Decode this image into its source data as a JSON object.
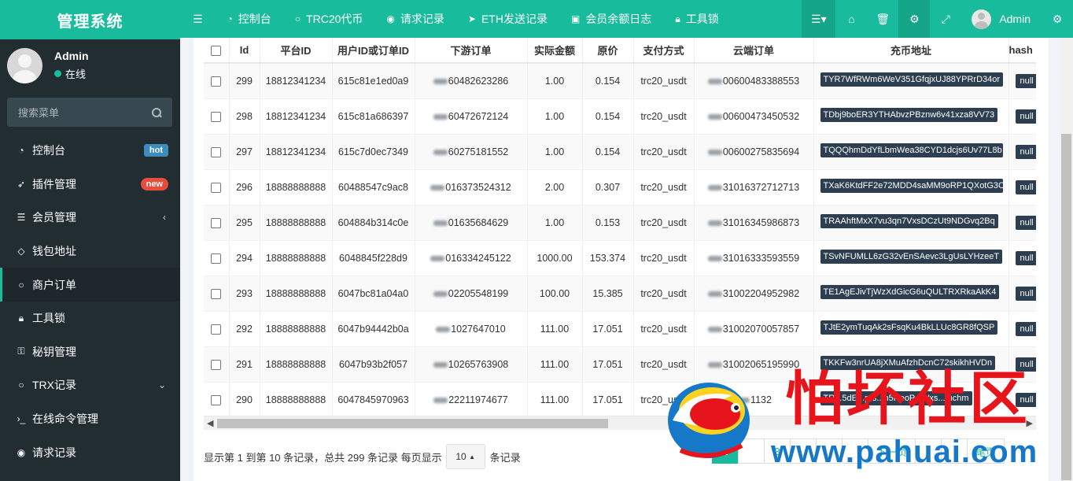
{
  "app": {
    "title": "管理系统"
  },
  "user": {
    "name": "Admin",
    "status": "在线"
  },
  "sidebar": {
    "search_placeholder": "搜索菜单",
    "items": [
      {
        "label": "控制台",
        "icon": "dashboard-icon",
        "badge": "hot"
      },
      {
        "label": "插件管理",
        "icon": "rocket-icon",
        "badge": "new"
      },
      {
        "label": "会员管理",
        "icon": "list-icon",
        "chevron": "‹"
      },
      {
        "label": "钱包地址",
        "icon": "diamond-icon"
      },
      {
        "label": "商户订单",
        "icon": "circle-icon",
        "active": true
      },
      {
        "label": "工具锁",
        "icon": "lock-icon"
      },
      {
        "label": "秘钥管理",
        "icon": "key-icon"
      },
      {
        "label": "TRX记录",
        "icon": "circle-icon",
        "chevron": "⌄"
      },
      {
        "label": "在线命令管理",
        "icon": "terminal-icon"
      },
      {
        "label": "请求记录",
        "icon": "arrow-circle-icon"
      }
    ]
  },
  "topbar": {
    "toggle_icon": "menu-toggle-icon",
    "tabs": [
      {
        "label": "控制台",
        "icon": "dashboard-icon"
      },
      {
        "label": "TRC20代币",
        "icon": "circle-icon"
      },
      {
        "label": "请求记录",
        "icon": "arrow-circle-icon"
      },
      {
        "label": "ETH发送记录",
        "icon": "send-icon"
      },
      {
        "label": "会员余额日志",
        "icon": "money-icon"
      },
      {
        "label": "工具锁",
        "icon": "lock-icon"
      }
    ],
    "user_name": "Admin"
  },
  "table": {
    "columns": [
      "Id",
      "平台ID",
      "用户ID或订单ID",
      "下游订单",
      "实际金额",
      "原价",
      "支付方式",
      "云端订单",
      "充币地址",
      "hash"
    ],
    "rows": [
      [
        "299",
        "18812341234",
        "615c81e1ed0a9",
        "60482623286",
        "1.00",
        "0.154",
        "trc20_usdt",
        "00600483388553",
        "TYR7WfRWm6WeV351GfqjxUJ88YPRrD34or",
        "null"
      ],
      [
        "298",
        "18812341234",
        "615c81a686397",
        "60472672124",
        "1.00",
        "0.154",
        "trc20_usdt",
        "00600473450532",
        "TDbj9boER3YTHAbvzPBznw6v41xza8VV73",
        "null"
      ],
      [
        "297",
        "18812341234",
        "615c7d0ec7349",
        "60275181552",
        "1.00",
        "0.154",
        "trc20_usdt",
        "00600275835694",
        "TQQQhmDdYfLbmWea38CYD1dcjs6Uv77L8b",
        "null"
      ],
      [
        "296",
        "18888888888",
        "60488547c9ac8",
        "016373524312",
        "2.00",
        "0.307",
        "trc20_usdt",
        "31016372712713",
        "TXaK6KtdFF2e72MDD4saMM9oRP1QXotG3C",
        "null"
      ],
      [
        "295",
        "18888888888",
        "604884b314c0e",
        "01635684629",
        "1.00",
        "0.153",
        "trc20_usdt",
        "31016345986873",
        "TRAAhftMxX7vu3qn7VxsDCzUt9NDGvq2Bq",
        "null"
      ],
      [
        "294",
        "18888888888",
        "6048845f228d9",
        "016334245122",
        "1000.00",
        "153.374",
        "trc20_usdt",
        "31016333593559",
        "TSvNFUMLL6zG32vEnSAevc3LgUsLYHzeeT",
        "null"
      ],
      [
        "293",
        "18888888888",
        "6047bc81a04a0",
        "02205548199",
        "100.00",
        "15.385",
        "trc20_usdt",
        "31002204952982",
        "TE1AgEJivTjWzXdGicG6uQULTRXRkaAkK4",
        "null"
      ],
      [
        "292",
        "18888888888",
        "6047b94442b0a",
        "1027647010",
        "111.00",
        "17.051",
        "trc20_usdt",
        "31002070057857",
        "TJtE2ymTuqAk2sFsqKu4BkLLUc8GR8fQSP",
        "null"
      ],
      [
        "291",
        "18888888888",
        "6047b93b2f057",
        "10265763908",
        "111.00",
        "17.051",
        "trc20_usdt",
        "31002065195990",
        "TKKFw3nrUA8jXMuAfzhDcnC72skikhHVDn",
        "null"
      ],
      [
        "290",
        "18888888888",
        "6047845970963",
        "22211974677",
        "111.00",
        "17.051",
        "trc20_usdt",
        "1132",
        "TR...5dE...prs...h5HeoP...Wxs...mchm",
        "null"
      ]
    ]
  },
  "footer": {
    "summary": "显示第 1 到第 10 条记录，总共 299 条记录 每页显示",
    "page_size": "10",
    "suffix": "条记录",
    "pages": [
      "1",
      "",
      "3",
      "",
      "",
      "",
      "下一页",
      "",
      "",
      "尾页"
    ]
  },
  "watermark": {
    "title": "怕坏社区",
    "url": "www.pahuai.com"
  },
  "colors": {
    "primary": "#18bc9c",
    "sidebar": "#222d32",
    "badge_hot": "#3c8dbc",
    "badge_new": "#e74c3c",
    "address_bg": "#2c3e50",
    "watermark_red": "#e8141c",
    "watermark_blue": "#1678c9"
  }
}
